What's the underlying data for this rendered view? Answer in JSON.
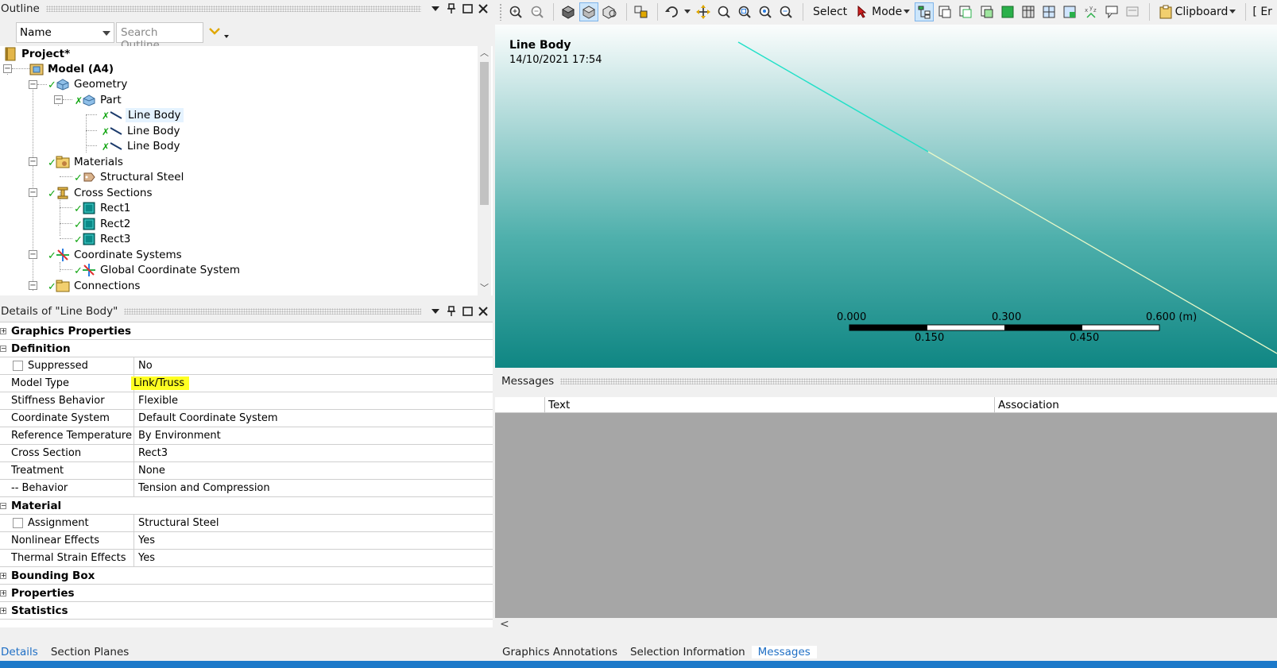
{
  "outline": {
    "title": "Outline",
    "filter_select": "Name",
    "search_placeholder": "Search Outline",
    "tree": [
      {
        "label": "Project*",
        "bold": true
      },
      {
        "label": "Model (A4)",
        "bold": true
      },
      {
        "label": "Geometry"
      },
      {
        "label": "Part"
      },
      {
        "label": "Line Body",
        "selected": true
      },
      {
        "label": "Line Body"
      },
      {
        "label": "Line Body"
      },
      {
        "label": "Materials"
      },
      {
        "label": "Structural Steel"
      },
      {
        "label": "Cross Sections"
      },
      {
        "label": "Rect1"
      },
      {
        "label": "Rect2"
      },
      {
        "label": "Rect3"
      },
      {
        "label": "Coordinate Systems"
      },
      {
        "label": "Global Coordinate System"
      },
      {
        "label": "Connections"
      }
    ]
  },
  "details": {
    "title": "Details of \"Line Body\"",
    "groups": {
      "graphics": "Graphics Properties",
      "definition": "Definition",
      "material": "Material",
      "bounding": "Bounding Box",
      "properties": "Properties",
      "statistics": "Statistics"
    },
    "rows": {
      "suppressed": {
        "key": "Suppressed",
        "value": "No"
      },
      "model_type": {
        "key": "Model Type",
        "value": "Link/Truss"
      },
      "stiffness": {
        "key": "Stiffness Behavior",
        "value": "Flexible"
      },
      "coord": {
        "key": "Coordinate System",
        "value": "Default Coordinate System"
      },
      "ref_temp": {
        "key": "Reference Temperature",
        "value": "By Environment"
      },
      "cross": {
        "key": "Cross Section",
        "value": "Rect3"
      },
      "treatment": {
        "key": "Treatment",
        "value": "None"
      },
      "behavior": {
        "key": "-- Behavior",
        "value": "Tension and Compression"
      },
      "assignment": {
        "key": "Assignment",
        "value": "Structural Steel"
      },
      "nonlinear": {
        "key": "Nonlinear Effects",
        "value": "Yes"
      },
      "thermal": {
        "key": "Thermal Strain Effects",
        "value": "Yes"
      }
    }
  },
  "left_tabs": {
    "details": "Details",
    "section_planes": "Section Planes"
  },
  "toolbar": {
    "select": "Select",
    "mode": "Mode",
    "clipboard": "Clipboard",
    "extra": "[ Er"
  },
  "viewport": {
    "title": "Line Body",
    "date": "14/10/2021 17:54",
    "scale_top": [
      "0.000",
      "0.300",
      "0.600 (m)"
    ],
    "scale_bottom": [
      "0.150",
      "0.450"
    ]
  },
  "messages": {
    "title": "Messages",
    "col_text": "Text",
    "col_assoc": "Association"
  },
  "right_tabs": {
    "annotations": "Graphics Annotations",
    "selection": "Selection Information",
    "messages": "Messages"
  },
  "colors": {
    "accent": "#1f6fc5",
    "highlight": "#ffff22",
    "status_bar": "#1c79c9",
    "check": "#11a511"
  }
}
